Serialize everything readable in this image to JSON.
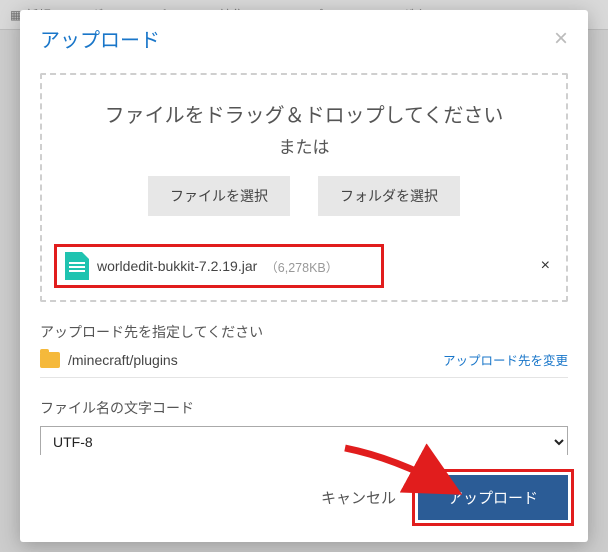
{
  "toolbar_bg": {
    "new_folder": "新規フォルダ",
    "copy": "コピー",
    "edit": "編集",
    "upload": "アップロード",
    "download": "ダウンロード"
  },
  "modal": {
    "title": "アップロード",
    "drop_heading": "ファイルをドラッグ＆ドロップしてください",
    "drop_or": "または",
    "select_file_btn": "ファイルを選択",
    "select_folder_btn": "フォルダを選択",
    "file": {
      "name": "worldedit-bukkit-7.2.19.jar",
      "size": "（6,278KB）"
    },
    "dest_label": "アップロード先を指定してください",
    "dest_path": "/minecraft/plugins",
    "dest_change": "アップロード先を変更",
    "encoding_label": "ファイル名の文字コード",
    "encoding_value": "UTF-8",
    "cancel": "キャンセル",
    "submit": "アップロード"
  }
}
